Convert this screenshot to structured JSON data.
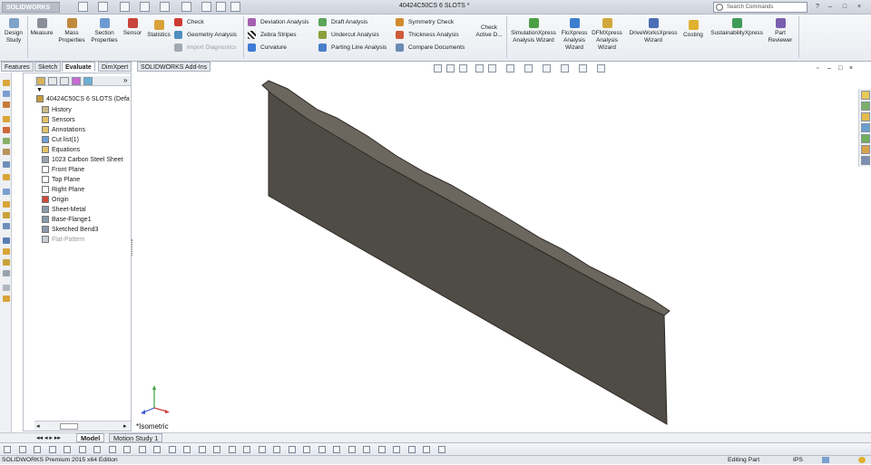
{
  "app": {
    "logo_text": "SOLIDWORKS",
    "document_title": "40424C50CS 6 SLOTS *"
  },
  "search": {
    "placeholder": "Search Commands"
  },
  "ribbon": {
    "large_buttons": [
      {
        "id": "design-study",
        "label1": "Design",
        "label2": "Study",
        "color": "#7fa3c9"
      },
      {
        "id": "measure",
        "label1": "Measure",
        "label2": "",
        "color": "#8a8f99"
      },
      {
        "id": "mass-properties",
        "label1": "Mass",
        "label2": "Properties",
        "color": "#c08a3e"
      },
      {
        "id": "section-properties",
        "label1": "Section",
        "label2": "Properties",
        "color": "#6d9bd1"
      },
      {
        "id": "sensor",
        "label1": "Sensor",
        "label2": "",
        "color": "#c9453c"
      },
      {
        "id": "statistics",
        "label1": "",
        "label2": "Statistics",
        "color": "#d8a13a"
      }
    ],
    "small_buttons_col1": [
      {
        "label": "Check",
        "color": "#cc3b30",
        "disabled": false
      },
      {
        "label": "Geometry Analysis",
        "color": "#4f8fc0",
        "disabled": false
      },
      {
        "label": "Import Diagnostics",
        "color": "#a3a9b3",
        "disabled": true
      }
    ],
    "small_buttons_col2": [
      {
        "label": "Deviation Analysis",
        "color": "#a45fb0"
      },
      {
        "label": "Zebra Stripes",
        "color": "#222222"
      },
      {
        "label": "Curvature",
        "color": "#3d7bd6"
      }
    ],
    "small_buttons_col3": [
      {
        "label": "Draft Analysis",
        "color": "#5aa55a"
      },
      {
        "label": "Undercut Analysis",
        "color": "#8aa03a"
      },
      {
        "label": "Parting Line Analysis",
        "color": "#4b7ec9"
      }
    ],
    "small_buttons_col4": [
      {
        "label": "Symmetry Check",
        "color": "#d28a2f"
      },
      {
        "label": "Thickness Analysis",
        "color": "#cf5a3a"
      },
      {
        "label": "Compare Documents",
        "color": "#6b8bb5"
      }
    ],
    "check_active": {
      "label1": "Check",
      "label2": "Active D..."
    },
    "xpress_buttons": [
      {
        "id": "simulationxpress",
        "label1": "SimulationXpress",
        "label2": "Analysis Wizard",
        "label3": "",
        "color": "#4aa043"
      },
      {
        "id": "floxpress",
        "label1": "FloXpress",
        "label2": "Analysis",
        "label3": "Wizard",
        "color": "#3c7fd0"
      },
      {
        "id": "dfmxpress",
        "label1": "DFMXpress",
        "label2": "Analysis",
        "label3": "Wizard",
        "color": "#d0a83c"
      },
      {
        "id": "driveworksxpress",
        "label1": "DriveWorksXpress",
        "label2": "Wizard",
        "label3": "",
        "color": "#4a6fb5"
      },
      {
        "id": "costing",
        "label1": "",
        "label2": "Costing",
        "label3": "",
        "color": "#e0b02f"
      },
      {
        "id": "sustainabilityxpress",
        "label1": "SustainabilityXpress",
        "label2": "",
        "label3": "",
        "color": "#3f9b58"
      },
      {
        "id": "part-reviewer",
        "label1": "Part",
        "label2": "Reviewer",
        "label3": "",
        "color": "#7a5fb0"
      }
    ]
  },
  "command_tabs": [
    "Features",
    "Sketch",
    "Evaluate",
    "DimXpert",
    "SOLIDWORKS Add-Ins"
  ],
  "feature_manager": {
    "items": [
      {
        "label": "40424C50CS 6 SLOTS  (Defa",
        "icon": "part-icon",
        "color": "#c89a3a",
        "dim": false
      },
      {
        "label": "History",
        "icon": "history-icon",
        "color": "#c9b98a",
        "dim": false
      },
      {
        "label": "Sensors",
        "icon": "sensors-folder-icon",
        "color": "#e0c26a",
        "dim": false
      },
      {
        "label": "Annotations",
        "icon": "annotations-icon",
        "color": "#e0c26a",
        "dim": false
      },
      {
        "label": "Cut list(1)",
        "icon": "cut-list-icon",
        "color": "#6e9fd6",
        "dim": false
      },
      {
        "label": "Equations",
        "icon": "equations-icon",
        "color": "#e0c26a",
        "dim": false
      },
      {
        "label": "1023 Carbon Steel Sheet",
        "icon": "material-icon",
        "color": "#9aa3ad",
        "dim": false
      },
      {
        "label": "Front Plane",
        "icon": "plane-icon",
        "color": "#ffffff",
        "dim": false
      },
      {
        "label": "Top Plane",
        "icon": "plane-icon",
        "color": "#ffffff",
        "dim": false
      },
      {
        "label": "Right Plane",
        "icon": "plane-icon",
        "color": "#ffffff",
        "dim": false
      },
      {
        "label": "Origin",
        "icon": "origin-icon",
        "color": "#d04a3a",
        "dim": false
      },
      {
        "label": "Sheet-Metal",
        "icon": "sheet-metal-icon",
        "color": "#8a9aa8",
        "dim": false
      },
      {
        "label": "Base-Flange1",
        "icon": "base-flange-icon",
        "color": "#8a9aa8",
        "dim": false
      },
      {
        "label": "Sketched Bend3",
        "icon": "sketched-bend-icon",
        "color": "#8a9aa8",
        "dim": false
      },
      {
        "label": "Flat-Pattern",
        "icon": "flat-pattern-icon",
        "color": "#c9ced5",
        "dim": true
      }
    ]
  },
  "viewport": {
    "view_label": "*Isometric",
    "part_color": "#4f4b45",
    "part_edge_color": "#2e2b27"
  },
  "bottom_tabs": [
    "Model",
    "Motion Study 1"
  ],
  "statusbar": {
    "edition": "SOLIDWORKS Premium 2015 x64 Edition",
    "mode": "Editing Part",
    "units": "IPS"
  }
}
